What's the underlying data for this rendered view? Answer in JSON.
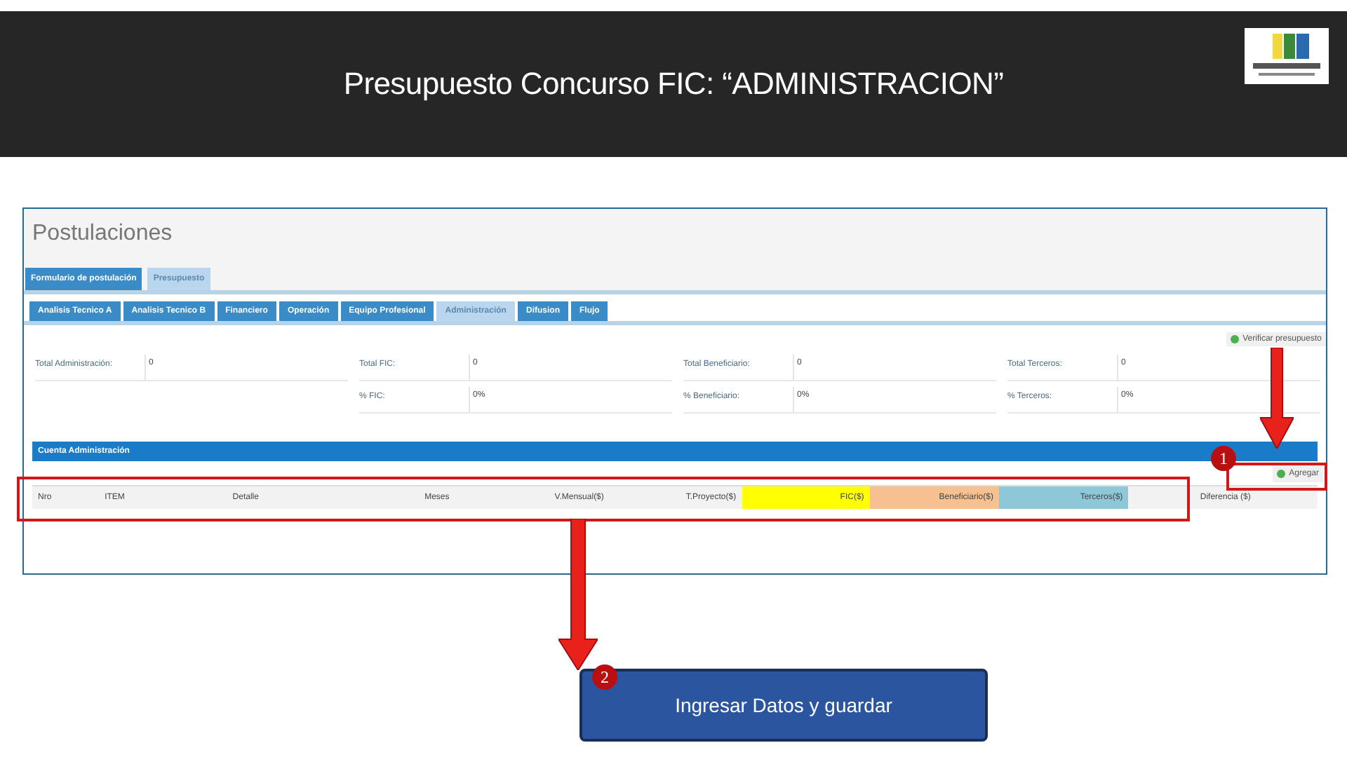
{
  "slide": {
    "title": "Presupuesto Concurso FIC: “ADMINISTRACION”"
  },
  "app": {
    "page_title": "Postulaciones",
    "main_tabs": [
      {
        "label": "Formulario de postulación",
        "selected": false
      },
      {
        "label": "Presupuesto",
        "selected": true
      }
    ],
    "sub_tabs": [
      {
        "label": "Analisis Tecnico A",
        "selected": false
      },
      {
        "label": "Analisis Tecnico B",
        "selected": false
      },
      {
        "label": "Financiero",
        "selected": false
      },
      {
        "label": "Operación",
        "selected": false
      },
      {
        "label": "Equipo Profesional",
        "selected": false
      },
      {
        "label": "Administración",
        "selected": true
      },
      {
        "label": "Difusion",
        "selected": false
      },
      {
        "label": "Flujo",
        "selected": false
      }
    ],
    "verify_button": "Verificar presupuesto",
    "totals": [
      {
        "rows": [
          {
            "label": "Total Administración:",
            "value": "0"
          }
        ]
      },
      {
        "rows": [
          {
            "label": "Total FIC:",
            "value": "0"
          },
          {
            "label": "% FIC:",
            "value": "0%"
          }
        ]
      },
      {
        "rows": [
          {
            "label": "Total Beneficiario:",
            "value": "0"
          },
          {
            "label": "% Beneficiario:",
            "value": "0%"
          }
        ]
      },
      {
        "rows": [
          {
            "label": "Total Terceros:",
            "value": "0"
          },
          {
            "label": "% Terceros:",
            "value": "0%"
          }
        ]
      }
    ],
    "section_title": "Cuenta Administración",
    "add_button": "Agregar",
    "table_columns": [
      {
        "label": "Nro"
      },
      {
        "label": "ITEM"
      },
      {
        "label": "Detalle"
      },
      {
        "label": "Meses"
      },
      {
        "label": "V.Mensual($)"
      },
      {
        "label": "T.Proyecto($)"
      },
      {
        "label": "FIC($)",
        "color": "#ffff00"
      },
      {
        "label": "Beneficiario($)",
        "color": "#f7c090"
      },
      {
        "label": "Terceros($)",
        "color": "#8ec8d8"
      },
      {
        "label": "Diferencia ($)"
      }
    ]
  },
  "annotations": {
    "badges": [
      "1",
      "2"
    ],
    "callout": "Ingresar Datos y guardar"
  }
}
